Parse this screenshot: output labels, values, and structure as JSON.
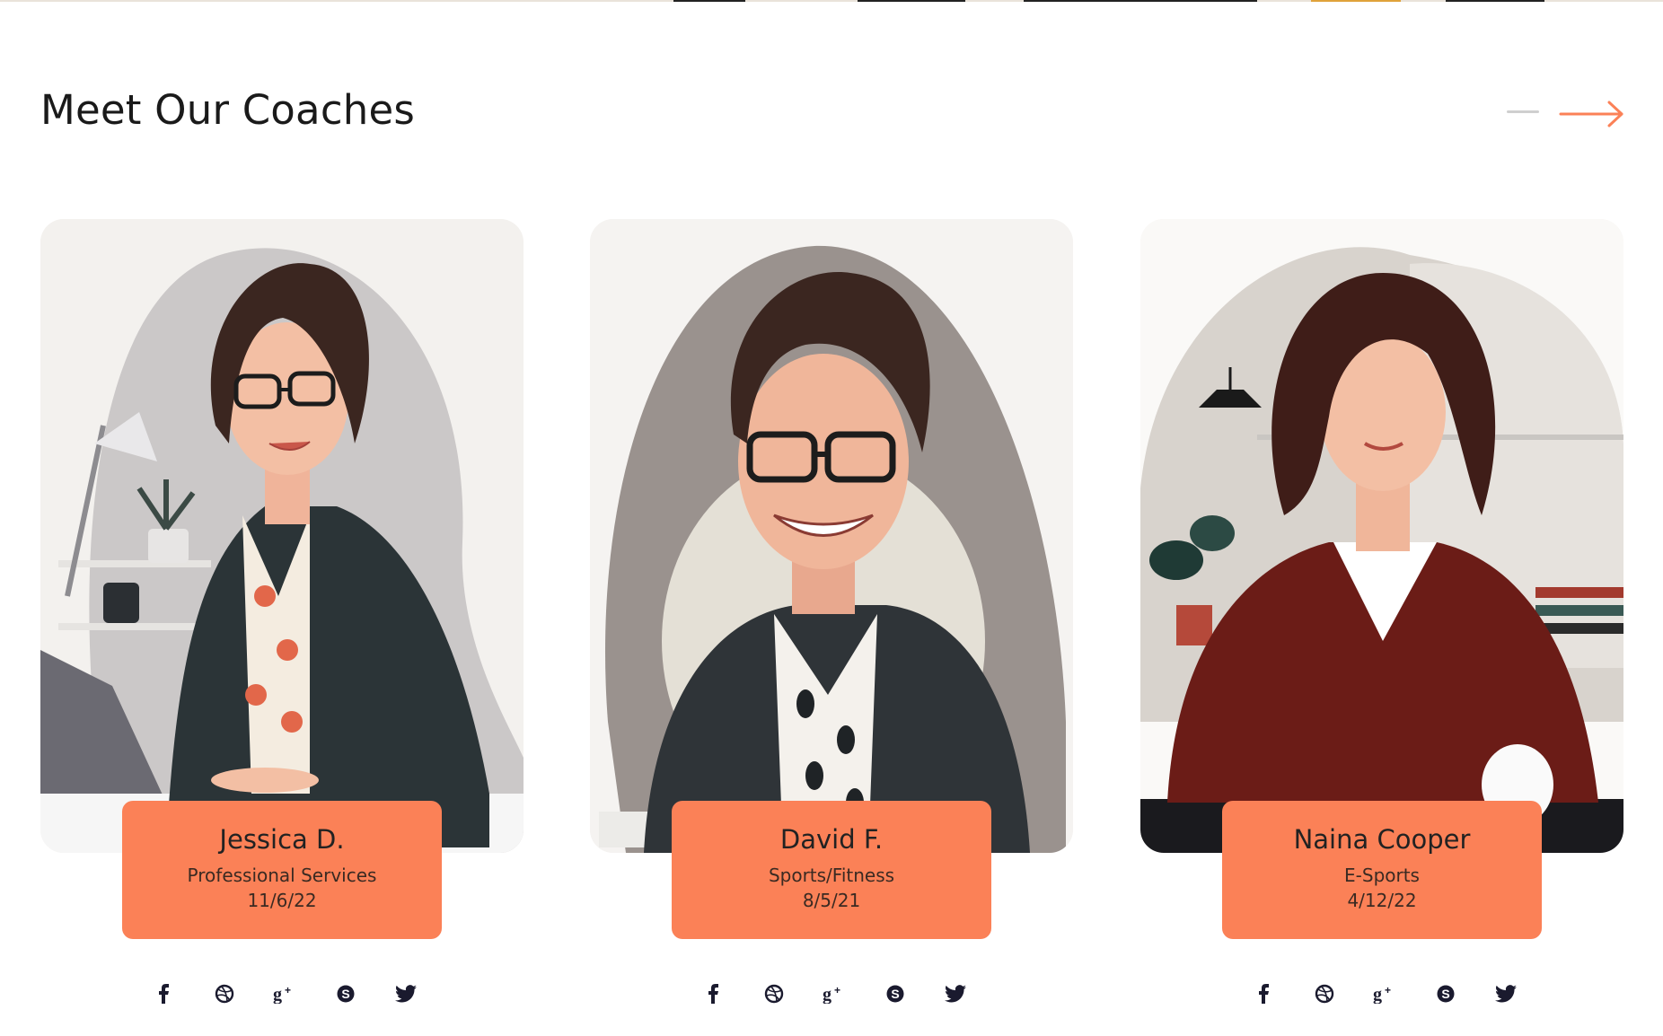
{
  "section": {
    "title": "Meet Our Coaches",
    "prev_icon": "dash-line-icon",
    "next_icon": "arrow-right-icon",
    "accent_color": "#fb8157"
  },
  "coaches": [
    {
      "name": "Jessica D.",
      "role": "Professional Services",
      "date": "11/6/22",
      "portrait": "illustrated woman with glasses at desk",
      "hair_color": "#3b2620",
      "top_color": "#2b3437",
      "bg_blob": "#c9c6c6"
    },
    {
      "name": "David F.",
      "role": "Sports/Fitness",
      "date": "8/5/21",
      "portrait": "illustrated man with glasses smiling",
      "hair_color": "#3b2620",
      "top_color": "#2f3438",
      "bg_blob": "#9a928e"
    },
    {
      "name": "Naina Cooper",
      "role": "E-Sports",
      "date": "4/12/22",
      "portrait": "illustrated woman in red sweater",
      "hair_color": "#3f1d18",
      "top_color": "#6b1c17",
      "bg_blob": "#d8d3cd"
    }
  ],
  "social_icons": [
    "facebook-icon",
    "dribbble-icon",
    "google-plus-icon",
    "skype-icon",
    "twitter-icon"
  ]
}
